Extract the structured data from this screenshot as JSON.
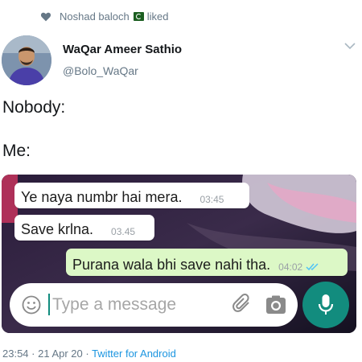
{
  "liked_by": {
    "name": "Noshad baloch",
    "action": "liked"
  },
  "author": {
    "display_name": "WaQar Ameer Sathio",
    "handle": "@Bolo_WaQar"
  },
  "tweet": {
    "line1": "Nobody:",
    "line2": "Me:"
  },
  "chat": {
    "messages": [
      {
        "text": "Ye naya numbr hai mera.",
        "time": "03:45"
      },
      {
        "text": "Save krlna.",
        "time": "03.45"
      },
      {
        "text": "Purana wala bhi save nahi tha.",
        "time": "04:02"
      }
    ],
    "input": {
      "placeholder": "Type a message"
    }
  },
  "footer": {
    "timestamp": "23:54 · 21 Apr 20 · ",
    "source": "Twitter for Android"
  },
  "colors": {
    "whatsapp_green": "#128c7e",
    "outgoing_bubble": "#dcf8c6",
    "twitter_link": "#1b95e0",
    "muted_text": "#657786"
  },
  "icons": [
    "heart-icon",
    "pakistan-flag-icon",
    "chevron-down-icon",
    "emoji-icon",
    "attach-icon",
    "camera-icon",
    "mic-icon",
    "double-check-icon"
  ]
}
